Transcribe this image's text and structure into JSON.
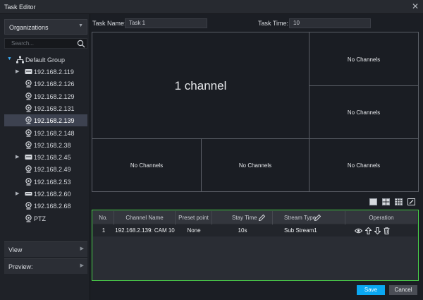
{
  "window": {
    "title": "Task Editor",
    "close_glyph": "✕"
  },
  "sidebar": {
    "org_label": "Organizations",
    "search_placeholder": "Search...",
    "root": "Default Group",
    "items": [
      {
        "label": "192.168.2.119",
        "type": "nvr",
        "expandable": true,
        "selected": false
      },
      {
        "label": "192.168.2.126",
        "type": "camera",
        "expandable": false,
        "selected": false
      },
      {
        "label": "192.168.2.129",
        "type": "camera",
        "expandable": false,
        "selected": false
      },
      {
        "label": "192.168.2.131",
        "type": "camera",
        "expandable": false,
        "selected": false
      },
      {
        "label": "192.168.2.139",
        "type": "camera",
        "expandable": false,
        "selected": true
      },
      {
        "label": "192.168.2.148",
        "type": "camera",
        "expandable": false,
        "selected": false
      },
      {
        "label": "192.168.2.38",
        "type": "camera",
        "expandable": false,
        "selected": false
      },
      {
        "label": "192.168.2.45",
        "type": "nvr",
        "expandable": true,
        "selected": false
      },
      {
        "label": "192.168.2.49",
        "type": "camera",
        "expandable": false,
        "selected": false
      },
      {
        "label": "192.168.2.53",
        "type": "camera",
        "expandable": false,
        "selected": false
      },
      {
        "label": "192.168.2.60",
        "type": "recorder",
        "expandable": true,
        "selected": false
      },
      {
        "label": "192.168.2.68",
        "type": "camera",
        "expandable": false,
        "selected": false
      },
      {
        "label": "PTZ",
        "type": "camera",
        "expandable": false,
        "selected": false
      }
    ],
    "view_label": "View",
    "preview_label": "Preview:"
  },
  "task": {
    "name_label": "Task Name:",
    "name_value": "Task 1",
    "time_label": "Task Time:",
    "time_value": "10"
  },
  "grid": {
    "main_text": "1 channel",
    "empty_text": "No Channels"
  },
  "table": {
    "headers": {
      "no": "No.",
      "channel": "Channel Name",
      "preset": "Preset point",
      "stay": "Stay Time",
      "stream": "Stream Type",
      "operation": "Operation"
    },
    "rows": [
      {
        "no": "1",
        "channel": "192.168.2.139: CAM 10",
        "preset": "None",
        "stay": "10s",
        "stream": "Sub Stream1"
      }
    ]
  },
  "buttons": {
    "save": "Save",
    "cancel": "Cancel"
  },
  "colors": {
    "accent": "#0aa8f2",
    "highlight_border": "#4ad04a",
    "selection": "#3d4250"
  }
}
